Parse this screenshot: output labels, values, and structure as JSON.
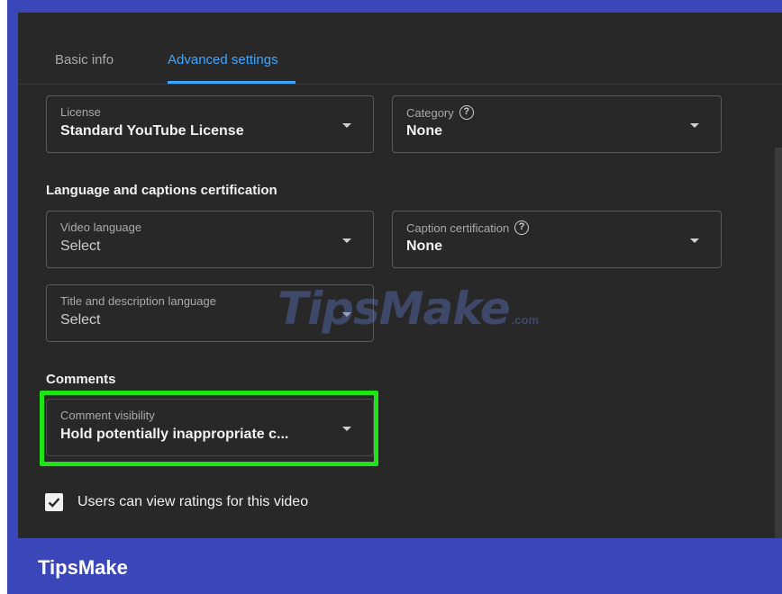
{
  "tabs": [
    {
      "label": "Basic info",
      "active": false
    },
    {
      "label": "Advanced settings",
      "active": true
    }
  ],
  "license": {
    "label": "License",
    "value": "Standard YouTube License"
  },
  "category": {
    "label": "Category",
    "value": "None"
  },
  "language_section": {
    "title": "Language and captions certification"
  },
  "video_language": {
    "label": "Video language",
    "value": "Select"
  },
  "caption_certification": {
    "label": "Caption certification",
    "value": "None"
  },
  "title_desc_language": {
    "label": "Title and description language",
    "value": "Select"
  },
  "comments_section": {
    "title": "Comments"
  },
  "comment_visibility": {
    "label": "Comment visibility",
    "value": "Hold potentially inappropriate c..."
  },
  "ratings": {
    "label": "Users can view ratings for this video",
    "checked": true
  },
  "watermark": {
    "main": "TipsMake",
    "sub": ".com"
  },
  "brand": {
    "label": "TipsMake"
  },
  "colors": {
    "accent": "#3ea6ff",
    "panel_bg": "#282828",
    "frame_blue": "#3b47b8",
    "highlight_green": "#1ee515"
  },
  "icons": {
    "help": "question-circle-icon",
    "dropdown": "caret-down-icon",
    "check": "checkmark-icon"
  }
}
